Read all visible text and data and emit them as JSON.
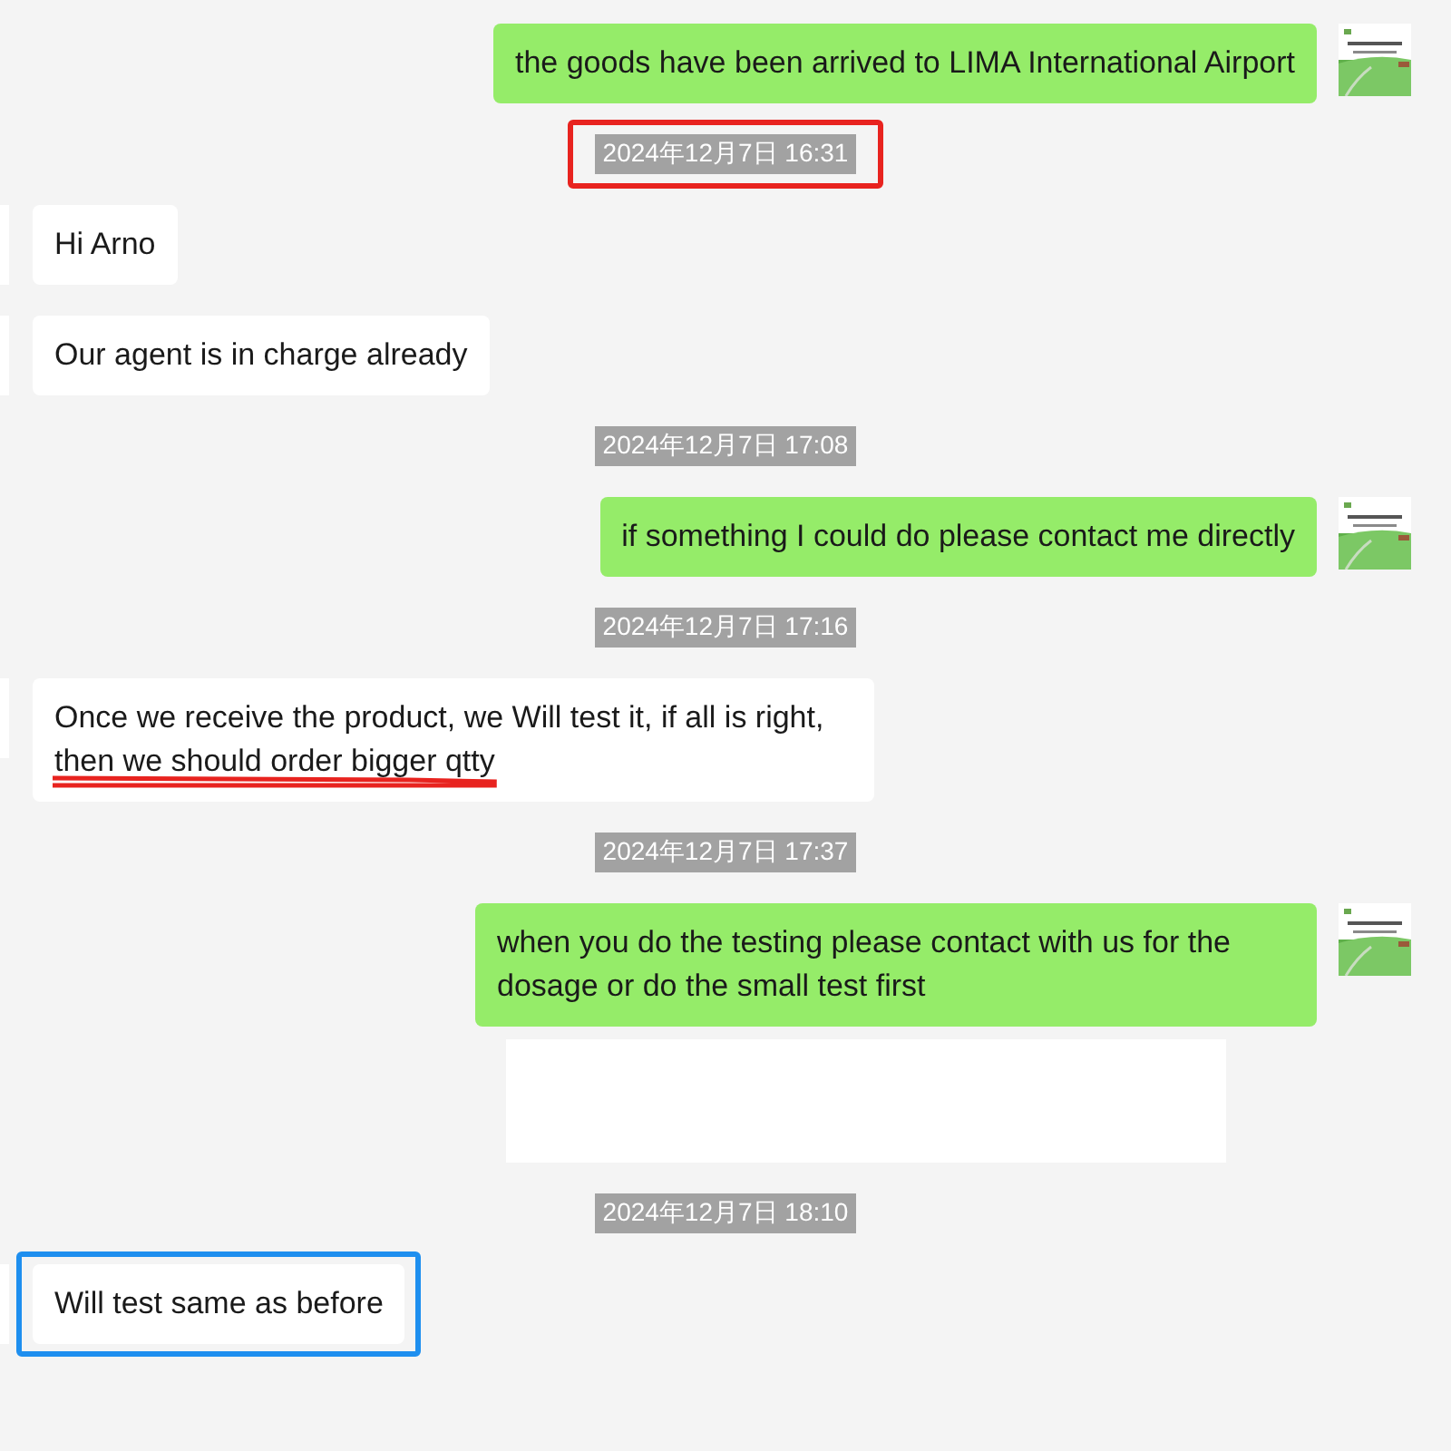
{
  "messages": [
    {
      "kind": "out",
      "text": "the goods have been arrived to LIMA International Airport"
    },
    {
      "kind": "time",
      "text": "2024年12月7日 16:31",
      "annotation": {
        "kind": "box",
        "color": "#e8231f"
      }
    },
    {
      "kind": "in",
      "text": "Hi Arno"
    },
    {
      "kind": "in",
      "text": "Our agent is in charge already"
    },
    {
      "kind": "time",
      "text": "2024年12月7日 17:08"
    },
    {
      "kind": "out",
      "text": "if something I could do please contact me directly"
    },
    {
      "kind": "time",
      "text": "2024年12月7日 17:16"
    },
    {
      "kind": "in",
      "text": "Once we receive the product, we Will test it, if all is right, then we should order bigger qtty",
      "annotation": {
        "kind": "underline",
        "color": "#e8231f"
      }
    },
    {
      "kind": "time",
      "text": "2024年12月7日 17:37"
    },
    {
      "kind": "out",
      "text": "when you do the testing please contact with us for the dosage or do the small test first"
    },
    {
      "kind": "blank"
    },
    {
      "kind": "time",
      "text": "2024年12月7日 18:10"
    },
    {
      "kind": "in",
      "text": "Will test same as before",
      "annotation": {
        "kind": "box",
        "color": "#1e8fef"
      }
    }
  ]
}
